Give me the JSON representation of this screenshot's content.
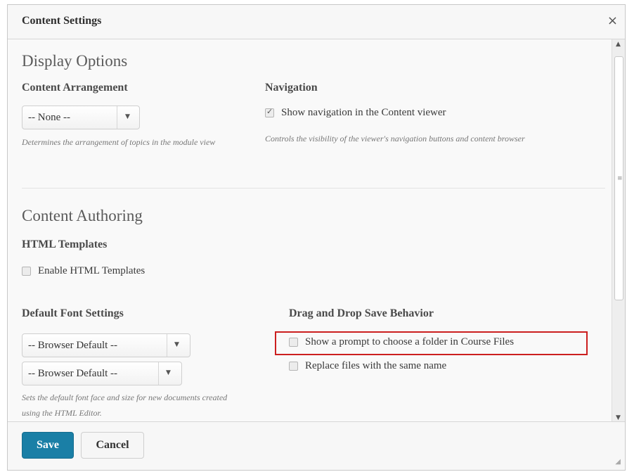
{
  "dialog": {
    "title": "Content Settings",
    "close_glyph": "×"
  },
  "display_options": {
    "heading": "Display Options",
    "content_arrangement": {
      "label": "Content Arrangement",
      "selected": "-- None --",
      "help": "Determines the arrangement of topics in the module view"
    },
    "navigation": {
      "label": "Navigation",
      "checkbox_label": "Show navigation in the Content viewer",
      "checked": true,
      "help": "Controls the visibility of the viewer's navigation buttons and content browser"
    }
  },
  "content_authoring": {
    "heading": "Content Authoring",
    "html_templates": {
      "label": "HTML Templates",
      "checkbox_label": "Enable HTML Templates",
      "checked": false
    },
    "default_font": {
      "label": "Default Font Settings",
      "font_face_selected": "-- Browser Default --",
      "font_size_selected": "-- Browser Default --",
      "help": "Sets the default font face and size for new documents created using the HTML Editor."
    },
    "drag_drop": {
      "label": "Drag and Drop Save Behavior",
      "options": [
        {
          "label": "Show a prompt to choose a folder in Course Files",
          "checked": false
        },
        {
          "label": "Replace files with the same name",
          "checked": false
        }
      ]
    }
  },
  "footer": {
    "save_label": "Save",
    "cancel_label": "Cancel"
  },
  "colors": {
    "primary_button": "#1a7fa6",
    "highlight_border": "#cc1f1f"
  }
}
